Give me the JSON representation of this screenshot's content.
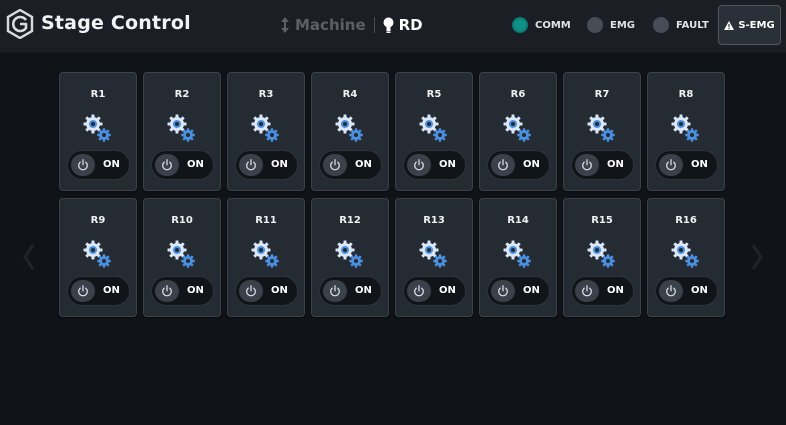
{
  "header": {
    "title": "Stage Control",
    "mode_machine": "Machine",
    "mode_rd": "RD"
  },
  "status": {
    "comm": {
      "label": "COMM",
      "color": "#0f8f86"
    },
    "emg": {
      "label": "EMG",
      "color": "#474d57"
    },
    "fault": {
      "label": "FAULT",
      "color": "#474d57"
    },
    "semg": {
      "label": "S-EMG"
    }
  },
  "stages": [
    {
      "label": "R1",
      "state": "ON"
    },
    {
      "label": "R2",
      "state": "ON"
    },
    {
      "label": "R3",
      "state": "ON"
    },
    {
      "label": "R4",
      "state": "ON"
    },
    {
      "label": "R5",
      "state": "ON"
    },
    {
      "label": "R6",
      "state": "ON"
    },
    {
      "label": "R7",
      "state": "ON"
    },
    {
      "label": "R8",
      "state": "ON"
    },
    {
      "label": "R9",
      "state": "ON"
    },
    {
      "label": "R10",
      "state": "ON"
    },
    {
      "label": "R11",
      "state": "ON"
    },
    {
      "label": "R12",
      "state": "ON"
    },
    {
      "label": "R13",
      "state": "ON"
    },
    {
      "label": "R14",
      "state": "ON"
    },
    {
      "label": "R15",
      "state": "ON"
    },
    {
      "label": "R16",
      "state": "ON"
    }
  ],
  "icons": {
    "logo": "app-logo-icon",
    "mode_machine": "updown-arrow-icon",
    "mode_rd": "lightbulb-icon",
    "stage": "gears-icon",
    "power": "power-icon",
    "warning": "warning-triangle-icon",
    "prev": "chevron-left-icon",
    "next": "chevron-right-icon"
  }
}
